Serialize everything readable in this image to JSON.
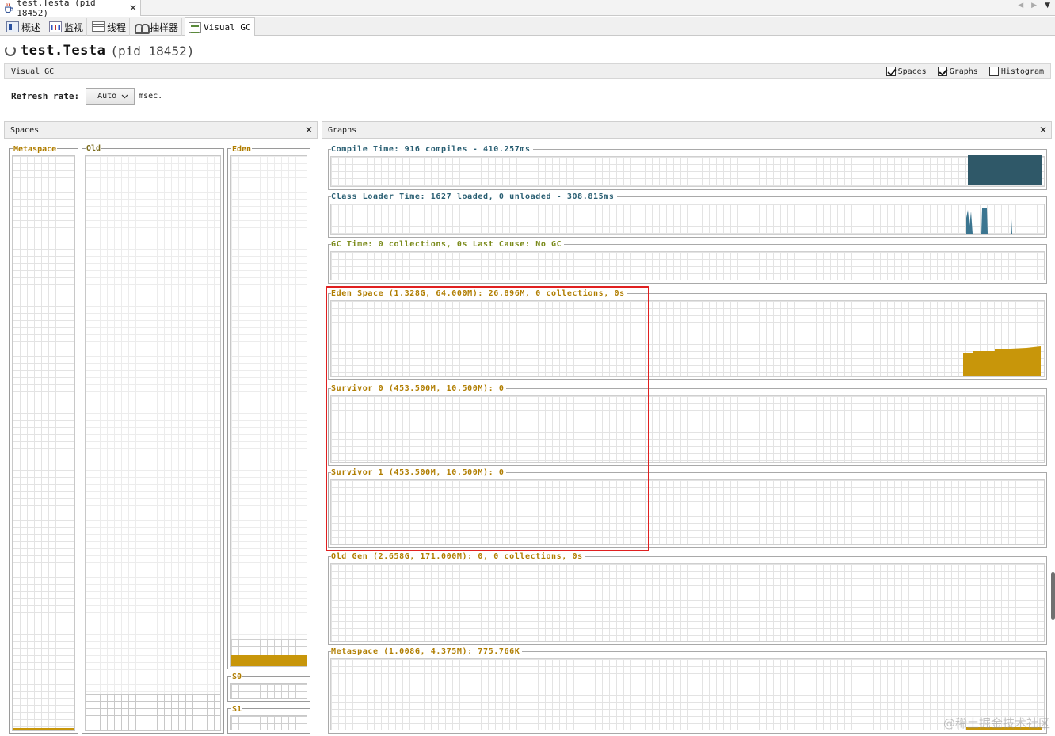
{
  "window": {
    "tab_title": "test.Testa (pid 18452)",
    "tab_close": "✕",
    "nav_arrows": [
      "◀",
      "▶",
      "▼"
    ]
  },
  "subtabs": [
    {
      "label": "概述",
      "icon": "overview-icon"
    },
    {
      "label": "监视",
      "icon": "monitor-icon"
    },
    {
      "label": "线程",
      "icon": "threads-icon"
    },
    {
      "label": "抽样器",
      "icon": "sampler-icon"
    },
    {
      "label": "Visual GC",
      "icon": "visual-gc-icon",
      "active": true
    }
  ],
  "page": {
    "title": "test.Testa",
    "pid": "(pid 18452)"
  },
  "toolbar": {
    "section_label": "Visual GC",
    "options": [
      {
        "label": "Spaces",
        "checked": true
      },
      {
        "label": "Graphs",
        "checked": true
      },
      {
        "label": "Histogram",
        "checked": false
      }
    ]
  },
  "refresh": {
    "label": "Refresh rate:",
    "value": "Auto",
    "unit": "msec."
  },
  "spaces_panel": {
    "title": "Spaces",
    "close": "✕",
    "labels": {
      "metaspace": "Metaspace",
      "old": "Old",
      "eden": "Eden",
      "s0": "S0",
      "s1": "S1"
    },
    "fill_levels": {
      "metaspace": 0.004,
      "old": 0.0,
      "eden": 0.42,
      "s0": 0.0,
      "s1": 0.0
    }
  },
  "graphs_panel": {
    "title": "Graphs",
    "close": "✕",
    "rows": [
      {
        "id": "compile",
        "label": "Compile Time: 916 compiles - 410.257ms"
      },
      {
        "id": "classloader",
        "label": "Class Loader Time: 1627 loaded, 0 unloaded - 308.815ms"
      },
      {
        "id": "gc",
        "label": "GC Time: 0 collections, 0s Last Cause: No GC"
      },
      {
        "id": "eden",
        "label": "Eden Space (1.328G, 64.000M): 26.896M, 0 collections, 0s"
      },
      {
        "id": "s0",
        "label": "Survivor 0 (453.500M, 10.500M): 0"
      },
      {
        "id": "s1",
        "label": "Survivor 1 (453.500M, 10.500M): 0"
      },
      {
        "id": "old",
        "label": "Old Gen (2.658G, 171.000M): 0, 0 collections, 0s"
      },
      {
        "id": "metaspace",
        "label": "Metaspace (1.008G, 4.375M): 775.766K"
      }
    ]
  },
  "colors": {
    "compile_series": "#2f5868",
    "classloader_series": "#3b7590",
    "eden_series": "#c8960a",
    "highlight": "#e02020"
  },
  "watermark": "@稀土掘金技术社区"
}
